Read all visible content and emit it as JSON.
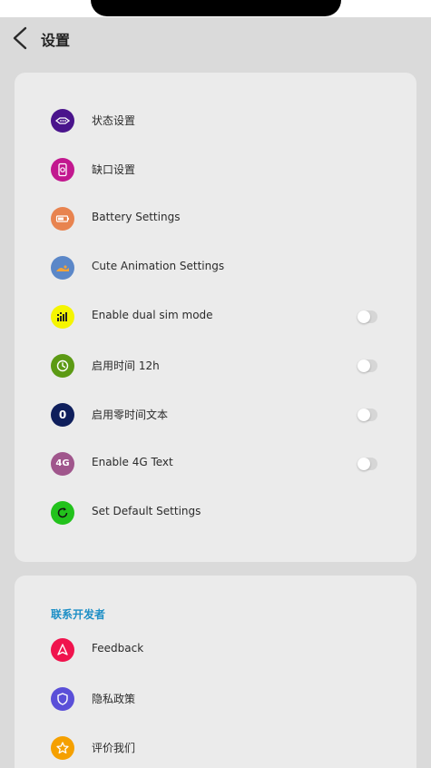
{
  "header": {
    "title": "设置"
  },
  "colors": {
    "accent": "#1e8fc6",
    "card_background": "#ebebeb",
    "page_background": "#dadada"
  },
  "settings": {
    "items": [
      {
        "label": "状态设置",
        "icon": "status-bar-icon",
        "icon_color": "#4a148c"
      },
      {
        "label": "缺口设置",
        "icon": "notch-phone-icon",
        "icon_color": "#c2188f"
      },
      {
        "label": "Battery Settings",
        "icon": "battery-icon",
        "icon_color": "#e8834f"
      },
      {
        "label": "Cute Animation Settings",
        "icon": "animation-icon",
        "icon_color": "#5b87c8"
      },
      {
        "label": "Enable dual sim mode",
        "icon": "dual-sim-icon",
        "icon_color": "#f5f500",
        "toggle": false
      },
      {
        "label": "启用时间 12h",
        "icon": "clock-icon",
        "icon_color": "#5c9a14",
        "toggle": false
      },
      {
        "label": "启用零时间文本",
        "icon": "zero-icon",
        "icon_color": "#0f1f5c",
        "icon_text": "0",
        "toggle": false
      },
      {
        "label": "Enable 4G Text",
        "icon": "4g-icon",
        "icon_color": "#a0568c",
        "icon_text": "4G",
        "toggle": false
      },
      {
        "label": "Set Default Settings",
        "icon": "reset-icon",
        "icon_color": "#22c21c"
      }
    ]
  },
  "developer": {
    "header": "联系开发者",
    "items": [
      {
        "label": "Feedback",
        "icon": "send-feedback-icon",
        "icon_color": "#f0134d"
      },
      {
        "label": "隐私政策",
        "icon": "shield-icon",
        "icon_color": "#5a4fd8"
      },
      {
        "label": "评价我们",
        "icon": "star-icon",
        "icon_color": "#f5a000"
      }
    ]
  }
}
